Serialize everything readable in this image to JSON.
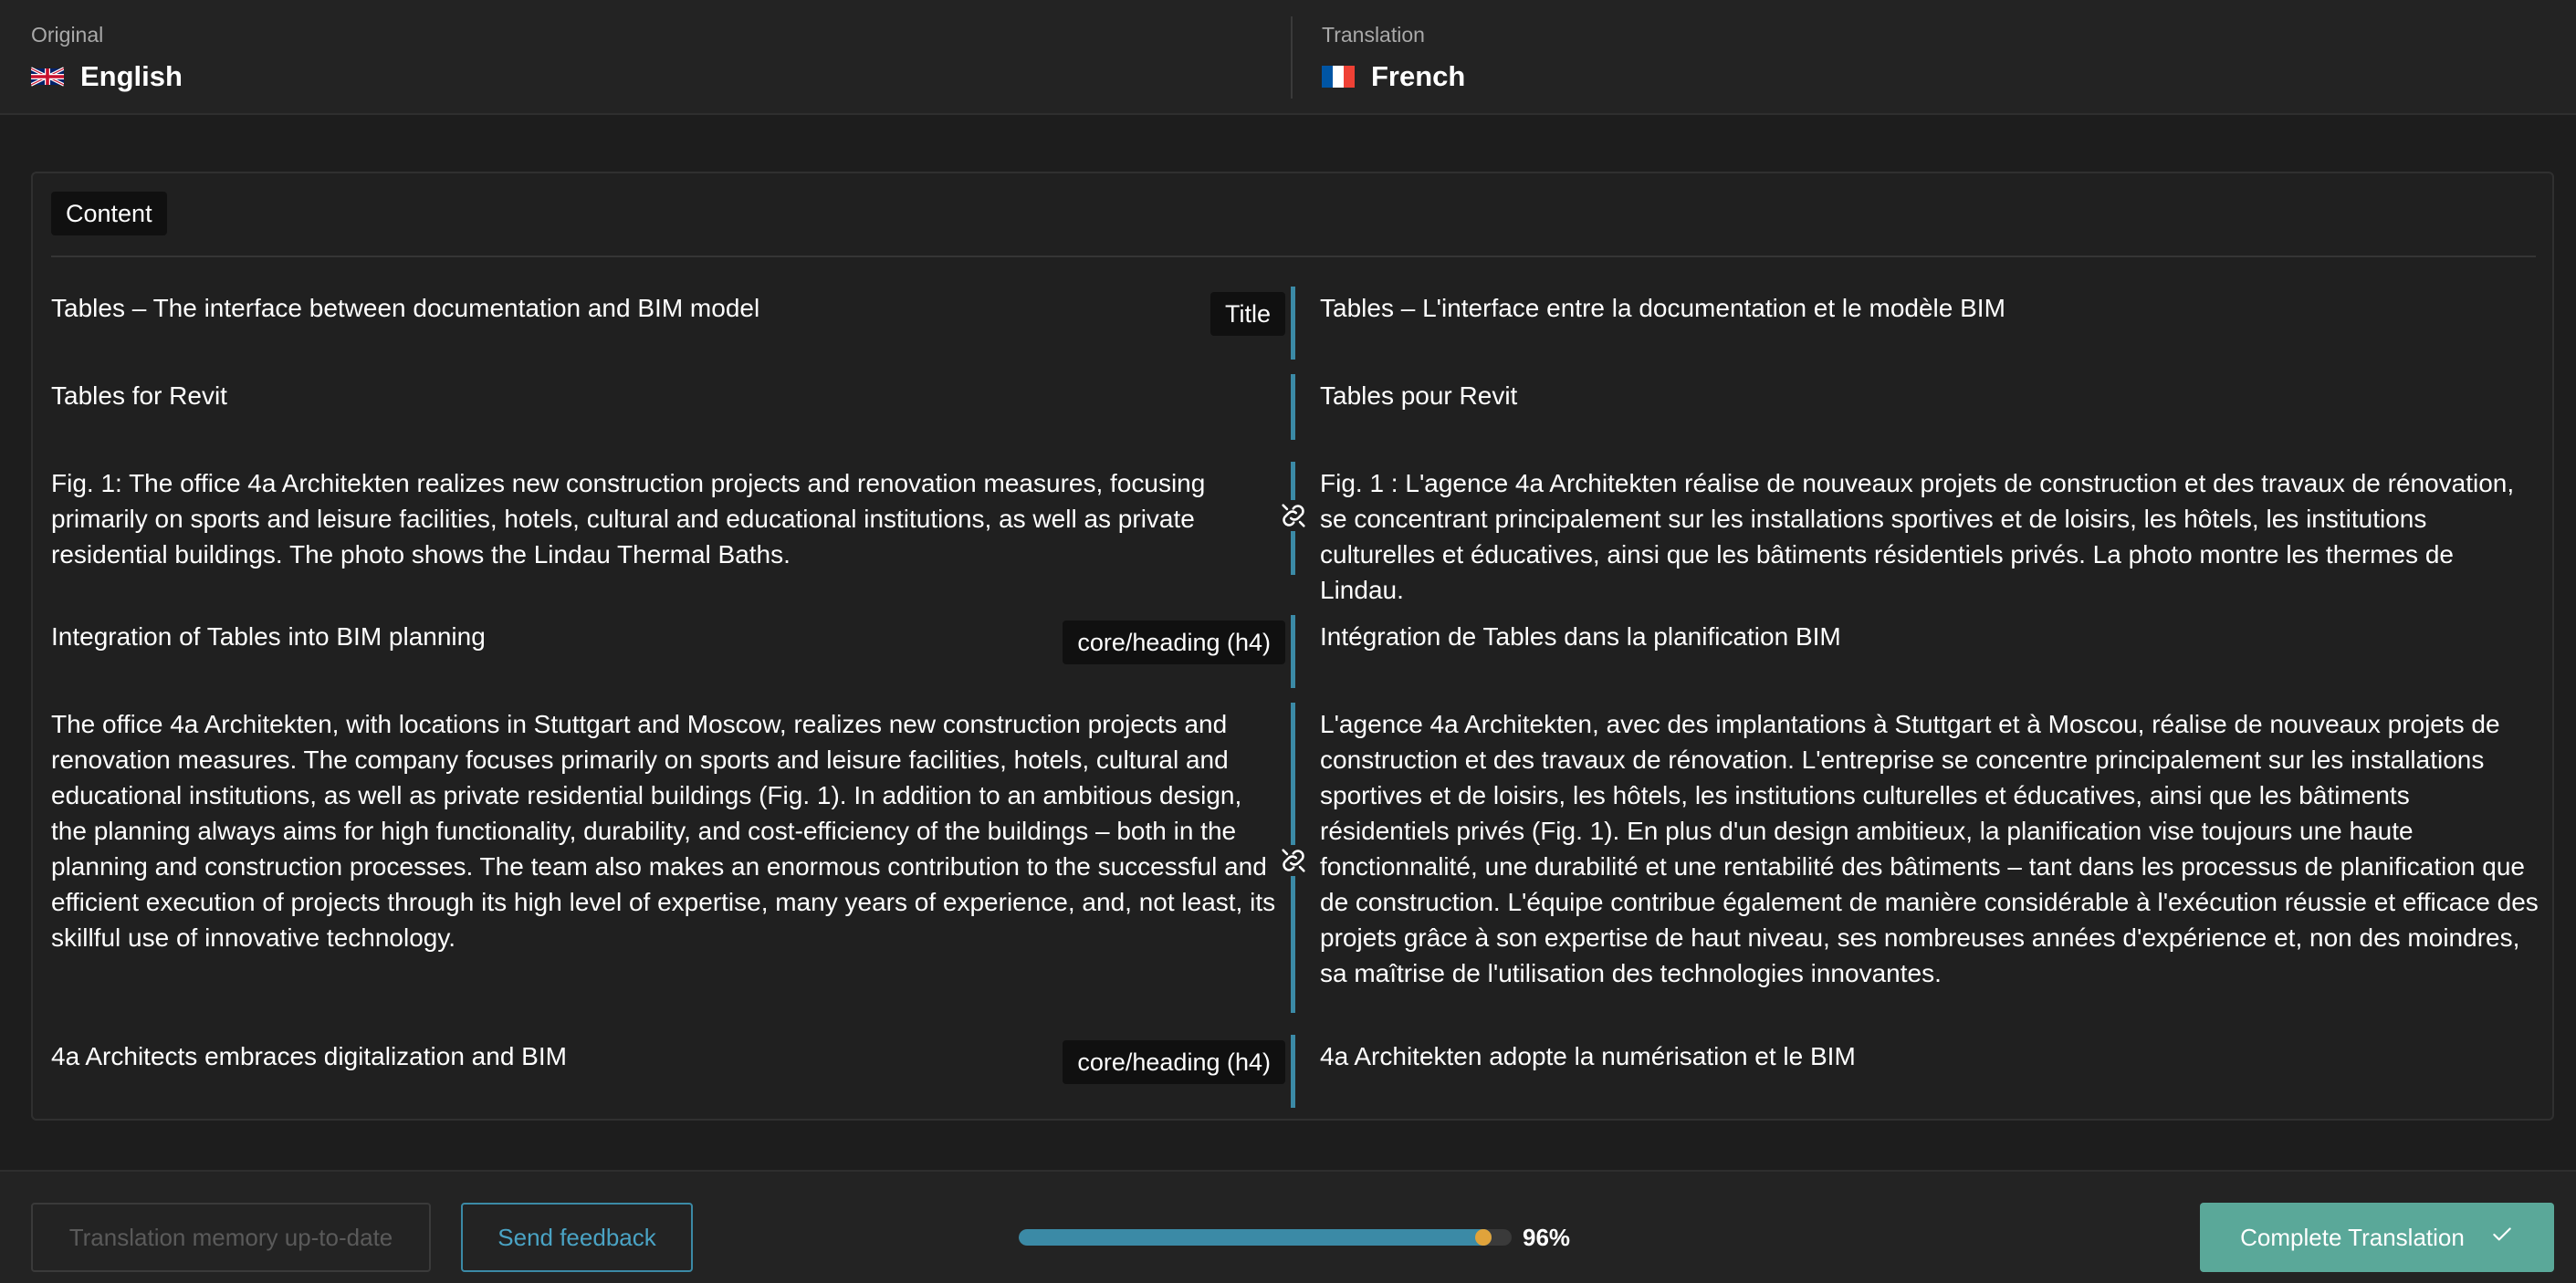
{
  "header": {
    "original": {
      "caption": "Original",
      "language": "English"
    },
    "translation": {
      "caption": "Translation",
      "language": "French"
    }
  },
  "panel": {
    "tag": "Content",
    "rows": [
      {
        "original": "Tables – The interface between documentation and BIM model",
        "translation": "Tables – L'interface entre la documentation et le modèle BIM",
        "tag": "Title"
      },
      {
        "original": "Tables for Revit",
        "translation": "Tables pour Revit"
      },
      {
        "original": "Fig. 1: The office 4a Architekten realizes new construction projects and renovation measures, focusing primarily on sports and leisure facilities, hotels, cultural and educational institutions, as well as private residential buildings. The photo shows the Lindau Thermal Baths.",
        "translation": "Fig. 1 : L'agence 4a Architekten réalise de nouveaux projets de construction et des travaux de rénovation, se concentrant principalement sur les installations sportives et de loisirs, les hôtels, les institutions culturelles et éducatives, ainsi que les bâtiments résidentiels privés. La photo montre les thermes de Lindau.",
        "icon": "link-icon"
      },
      {
        "original": "Integration of Tables into BIM planning",
        "translation": "Intégration de Tables dans la planification BIM",
        "tag": "core/heading (h4)"
      },
      {
        "original": "The office 4a Architekten, with locations in Stuttgart and Moscow, realizes new construction projects and renovation measures. The company focuses primarily on sports and leisure facilities, hotels, cultural and educational institutions, as well as private residential buildings (Fig. 1). In addition to an ambitious design, the planning always aims for high functionality, durability, and cost-efficiency of the buildings – both in the planning and construction processes. The team also makes an enormous contribution to the successful and efficient execution of projects through its high level of expertise, many years of experience, and, not least, its skillful use of innovative technology.",
        "translation": "L'agence 4a Architekten, avec des implantations à Stuttgart et à Moscou, réalise de nouveaux projets de construction et des travaux de rénovation. L'entreprise se concentre principalement sur les installations sportives et de loisirs, les hôtels, les institutions culturelles et éducatives, ainsi que les bâtiments résidentiels privés (Fig. 1). En plus d'un design ambitieux, la planification vise toujours une haute fonctionnalité, une durabilité et une rentabilité des bâtiments – tant dans les processus de planification que de construction. L'équipe contribue également de manière considérable à l'exécution réussie et efficace des projets grâce à son expertise de haut niveau, ses nombreuses années d'expérience et, non des moindres, sa maîtrise de l'utilisation des technologies innovantes.",
        "icon": "link-icon"
      },
      {
        "original": "4a Architects embraces digitalization and BIM",
        "translation": "4a Architekten adopte la numérisation et le BIM",
        "tag": "core/heading (h4)"
      }
    ]
  },
  "footer": {
    "memory_button": "Translation memory up-to-date",
    "feedback_button": "Send feedback",
    "progress_value": 0.96,
    "progress_label": "96%",
    "complete_button": "Complete Translation"
  },
  "colors": {
    "accent": "#3b8aa6",
    "progress_end": "#e0a33b",
    "complete": "#5aa899"
  }
}
